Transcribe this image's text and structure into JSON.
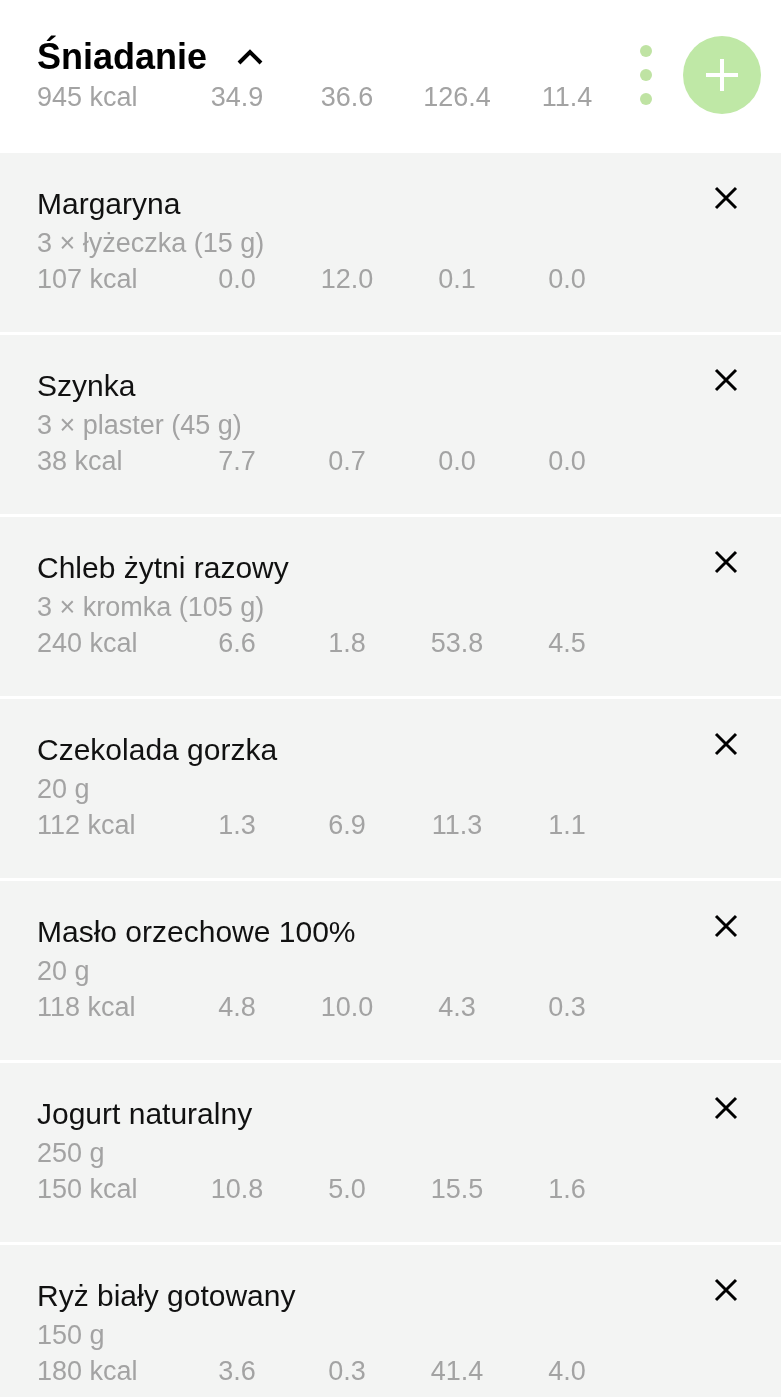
{
  "meal": {
    "title": "Śniadanie",
    "expanded": true,
    "totals": [
      "945 kcal",
      "34.9",
      "36.6",
      "126.4",
      "11.4"
    ]
  },
  "items": [
    {
      "name": "Margaryna",
      "portion": "3 × łyżeczka (15 g)",
      "values": [
        "107 kcal",
        "0.0",
        "12.0",
        "0.1",
        "0.0"
      ]
    },
    {
      "name": "Szynka",
      "portion": "3 × plaster (45 g)",
      "values": [
        "38 kcal",
        "7.7",
        "0.7",
        "0.0",
        "0.0"
      ]
    },
    {
      "name": "Chleb żytni razowy",
      "portion": "3 × kromka (105 g)",
      "values": [
        "240 kcal",
        "6.6",
        "1.8",
        "53.8",
        "4.5"
      ]
    },
    {
      "name": "Czekolada gorzka",
      "portion": "20 g",
      "values": [
        "112 kcal",
        "1.3",
        "6.9",
        "11.3",
        "1.1"
      ]
    },
    {
      "name": "Masło orzechowe 100%",
      "portion": "20 g",
      "values": [
        "118 kcal",
        "4.8",
        "10.0",
        "4.3",
        "0.3"
      ]
    },
    {
      "name": "Jogurt naturalny",
      "portion": "250 g",
      "values": [
        "150 kcal",
        "10.8",
        "5.0",
        "15.5",
        "1.6"
      ]
    },
    {
      "name": "Ryż biały gotowany",
      "portion": "150 g",
      "values": [
        "180 kcal",
        "3.6",
        "0.3",
        "41.4",
        "4.0"
      ]
    }
  ]
}
